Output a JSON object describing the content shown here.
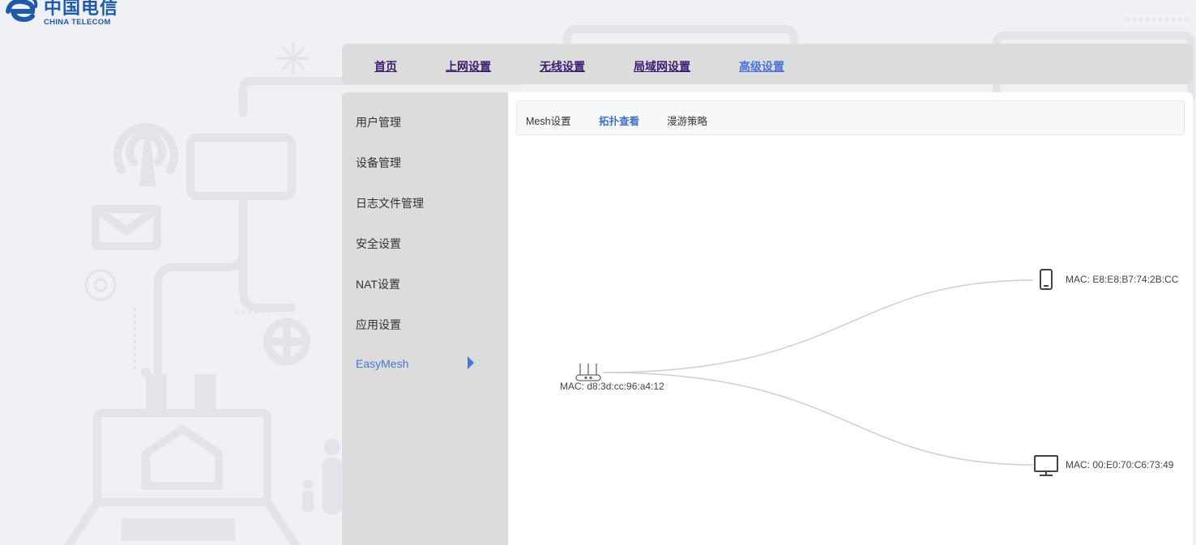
{
  "brand": {
    "name_cn": "中国电信",
    "name_en": "CHINA TELECOM"
  },
  "topnav": {
    "items": [
      {
        "label": "首页",
        "active": false
      },
      {
        "label": "上网设置",
        "active": false
      },
      {
        "label": "无线设置",
        "active": false
      },
      {
        "label": "局域网设置",
        "active": false
      },
      {
        "label": "高级设置",
        "active": true
      }
    ]
  },
  "sidebar": {
    "items": [
      {
        "label": "用户管理"
      },
      {
        "label": "设备管理"
      },
      {
        "label": "日志文件管理"
      },
      {
        "label": "安全设置"
      },
      {
        "label": "NAT设置"
      },
      {
        "label": "应用设置"
      },
      {
        "label": "EasyMesh",
        "active": true
      }
    ]
  },
  "subtabs": {
    "items": [
      {
        "label": "Mesh设置"
      },
      {
        "label": "拓扑查看",
        "active": true
      },
      {
        "label": "漫游策略"
      }
    ]
  },
  "topology": {
    "root": {
      "mac": "MAC: d8:3d:cc:96:a4:12",
      "icon": "router-icon"
    },
    "children": [
      {
        "mac": "MAC: E8:E8:B7:74:2B:CC",
        "icon": "phone-icon"
      },
      {
        "mac": "MAC: 00:E0:70:C6:73:49",
        "icon": "monitor-icon"
      }
    ]
  },
  "colors": {
    "accent": "#4a74d9",
    "nav_text": "#3a1d6e",
    "panel_bg": "#dcdcdc",
    "link_line": "#cfcfcf"
  }
}
